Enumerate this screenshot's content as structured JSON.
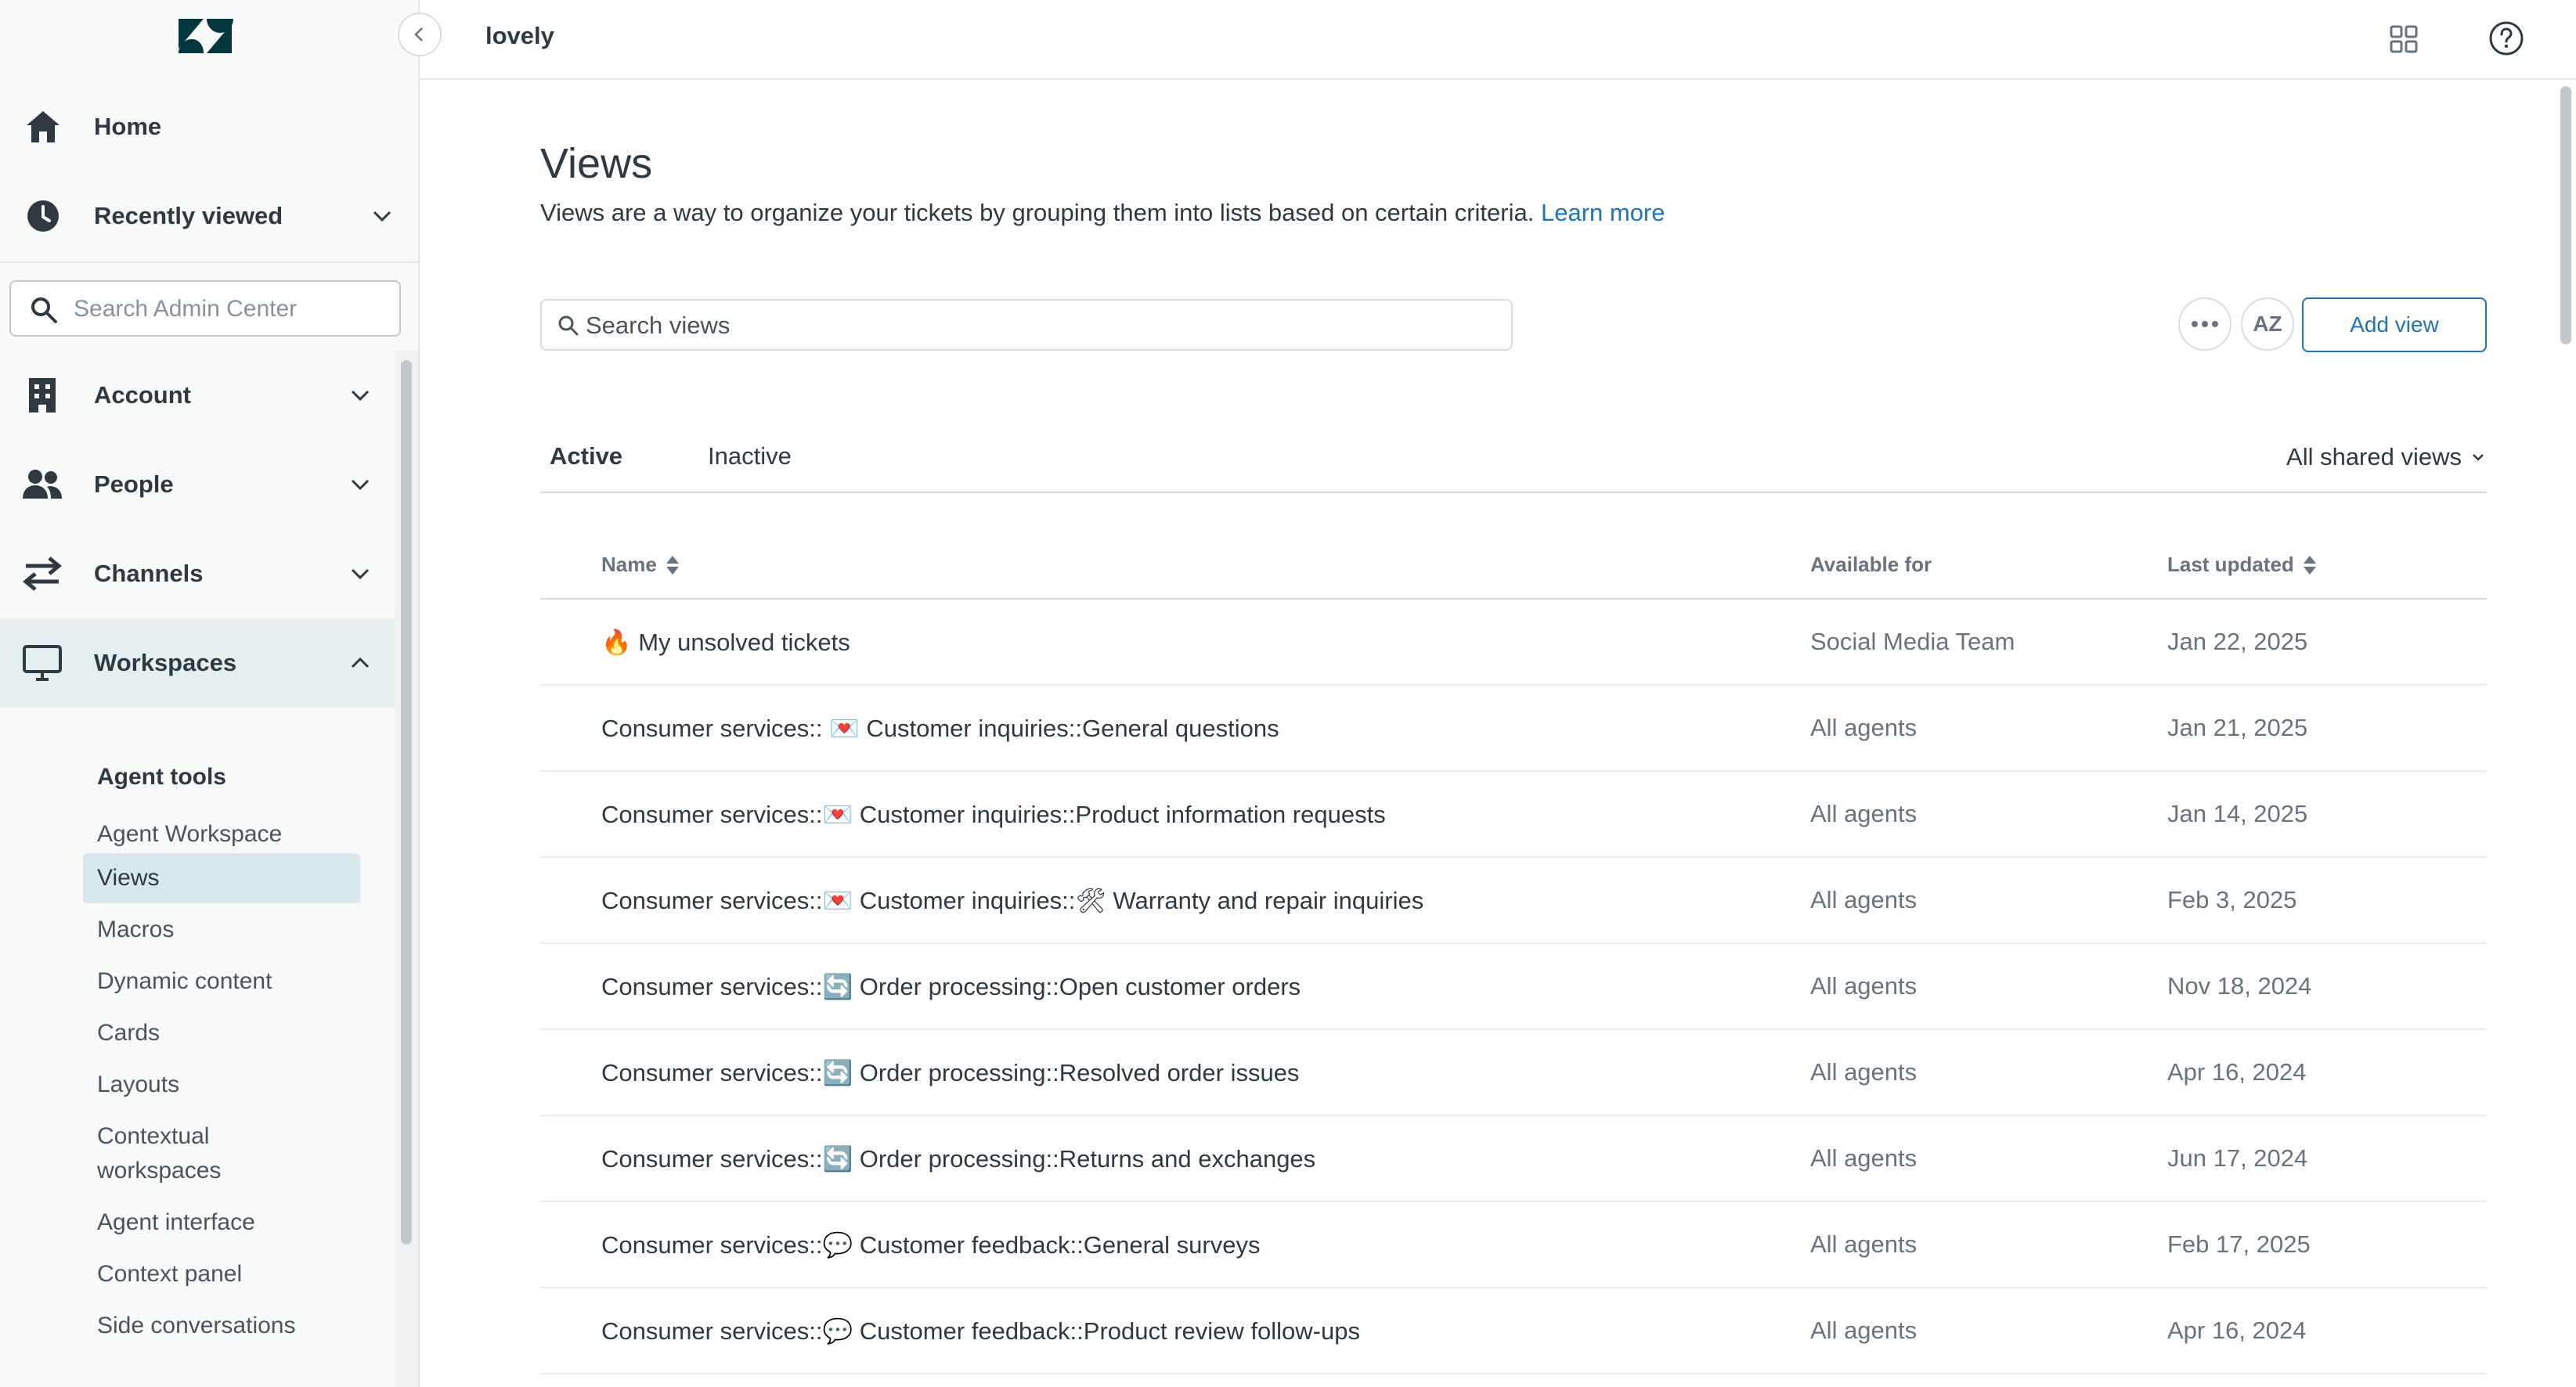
{
  "sidebar": {
    "home": "Home",
    "recently_viewed": "Recently viewed",
    "search_placeholder": "Search Admin Center",
    "sections": {
      "account": "Account",
      "people": "People",
      "channels": "Channels",
      "workspaces": "Workspaces"
    },
    "sub_heading": "Agent tools",
    "sub_items": [
      "Agent Workspace",
      "Views",
      "Macros",
      "Dynamic content",
      "Cards",
      "Layouts",
      "Contextual workspaces",
      "Agent interface",
      "Context panel",
      "Side conversations"
    ],
    "active_sub_item": "Views"
  },
  "header": {
    "account_name": "lovely",
    "icons": [
      "zendesk-logo",
      "chevron-left-icon",
      "apps-grid-icon",
      "help-icon"
    ]
  },
  "main": {
    "title": "Views",
    "description": "Views are a way to organize your tickets by grouping them into lists based on certain criteria.",
    "learn_more": "Learn more",
    "search_placeholder": "Search views",
    "sort_label": "AZ",
    "add_view_label": "Add view",
    "tabs": {
      "active": "Active",
      "inactive": "Inactive"
    },
    "filter_label": "All shared views",
    "columns": {
      "name": "Name",
      "available_for": "Available for",
      "last_updated": "Last updated"
    },
    "rows": [
      {
        "name": "🔥 My unsolved tickets",
        "available_for": "Social Media Team",
        "last_updated": "Jan 22, 2025"
      },
      {
        "name": "Consumer services:: 💌 Customer inquiries::General questions",
        "available_for": "All agents",
        "last_updated": "Jan 21, 2025"
      },
      {
        "name": "Consumer services::💌 Customer inquiries::Product information requests",
        "available_for": "All agents",
        "last_updated": "Jan 14, 2025"
      },
      {
        "name": "Consumer services::💌 Customer inquiries::🛠 Warranty and repair inquiries",
        "available_for": "All agents",
        "last_updated": "Feb 3, 2025"
      },
      {
        "name": "Consumer services::🔄 Order processing::Open customer orders",
        "available_for": "All agents",
        "last_updated": "Nov 18, 2024"
      },
      {
        "name": "Consumer services::🔄 Order processing::Resolved order issues",
        "available_for": "All agents",
        "last_updated": "Apr 16, 2024"
      },
      {
        "name": "Consumer services::🔄 Order processing::Returns and exchanges",
        "available_for": "All agents",
        "last_updated": "Jun 17, 2024"
      },
      {
        "name": "Consumer services::💬 Customer feedback::General surveys",
        "available_for": "All agents",
        "last_updated": "Feb 17, 2025"
      },
      {
        "name": "Consumer services::💬 Customer feedback::Product review follow-ups",
        "available_for": "All agents",
        "last_updated": "Apr 16, 2024"
      }
    ]
  },
  "colors": {
    "link": "#1f73b7",
    "selected_nav_bg": "#e6eff0",
    "selected_sub_bg": "#d8e8ea",
    "text": "#2f3941",
    "muted": "#68737d"
  }
}
